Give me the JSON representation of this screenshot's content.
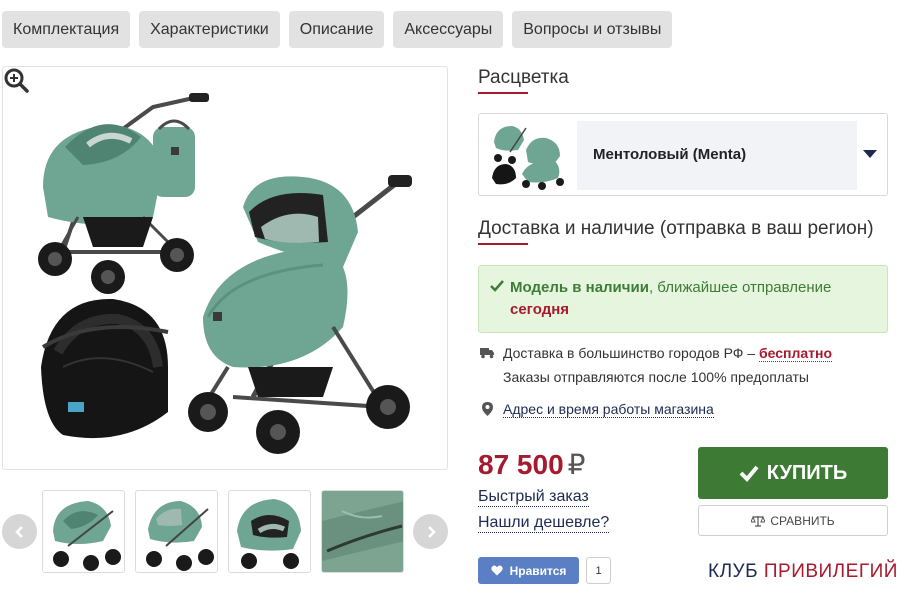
{
  "tabs": [
    "Комплектация",
    "Характеристики",
    "Описание",
    "Аксессуары",
    "Вопросы и отзывы"
  ],
  "color_section": {
    "title": "Расцветка",
    "selected": "Ментоловый (Menta)"
  },
  "delivery_section": {
    "title": "Доставка и наличие (отправка в ваш регион)",
    "stock_strong": "Модель в наличии",
    "stock_rest": ", ближайшее отправление",
    "stock_when": "сегодня",
    "delivery_prefix": "Доставка в большинство городов РФ –",
    "delivery_free": "бесплатно",
    "prepay_note": "Заказы отправляются после 100% предоплаты",
    "store_link": "Адрес и время работы магазина"
  },
  "price": {
    "value": "87 500",
    "currency": "₽"
  },
  "links": {
    "quick_order": "Быстрый заказ",
    "found_cheaper": "Нашли дешевле?"
  },
  "buttons": {
    "buy": "КУПИТЬ",
    "compare": "СРАВНИТЬ",
    "like": "Нравится",
    "like_count": "1"
  },
  "club": {
    "part1": "КЛУБ",
    "part2": "ПРИВИЛЕГИЙ"
  },
  "colors": {
    "accent": "#a6192e",
    "buy": "#3d7a33",
    "navy": "#1d2a52",
    "mint": "#6fa593",
    "like": "#5b7fc4",
    "stock_bg": "#e6f5de"
  }
}
